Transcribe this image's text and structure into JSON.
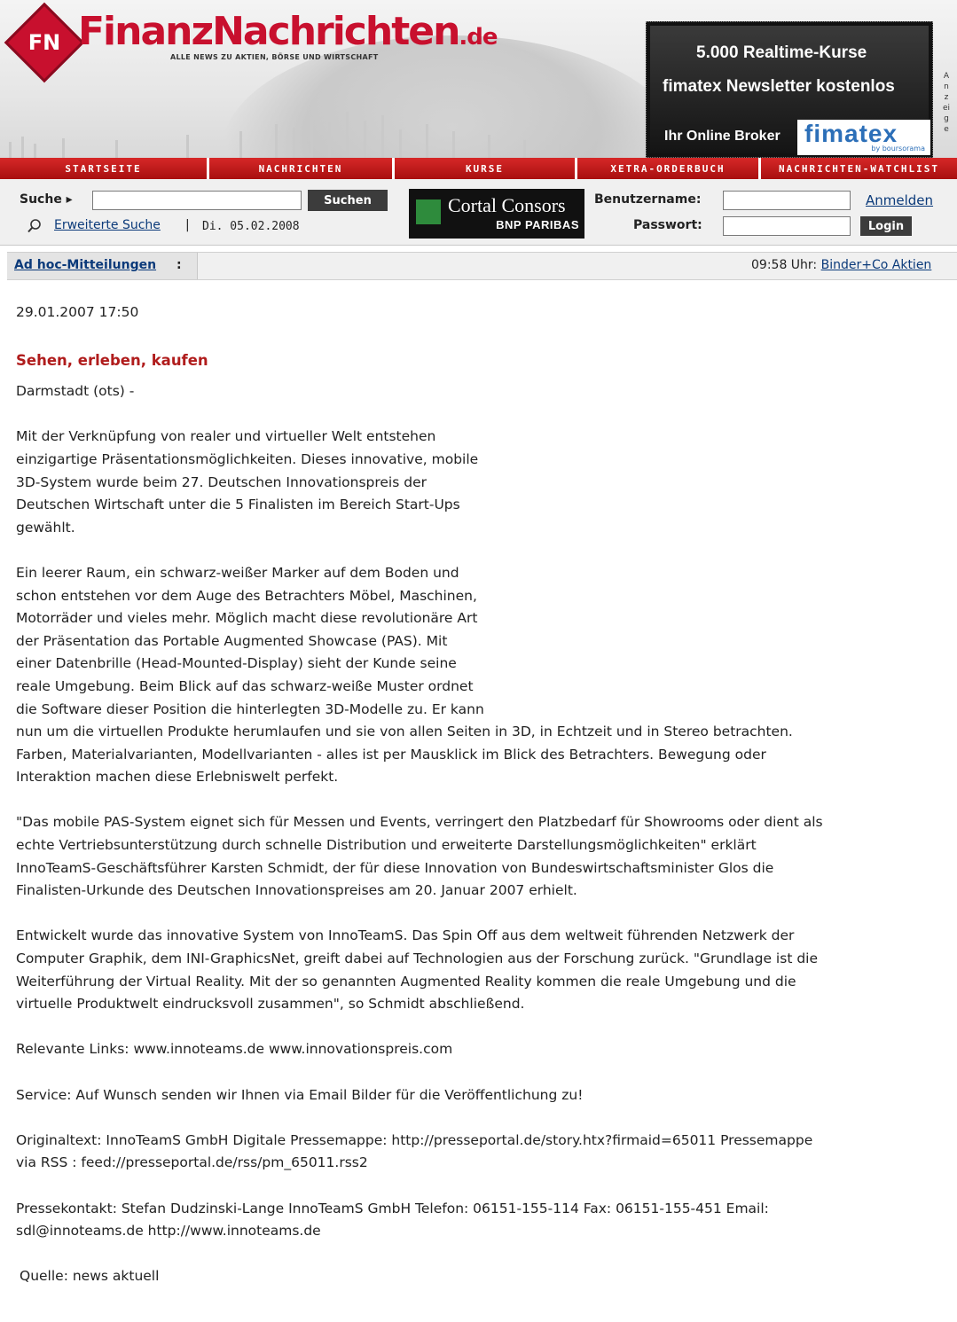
{
  "header": {
    "logo_badge": "FN",
    "logo_part1": "Finanz",
    "logo_part2": "Nachrichten",
    "logo_tld": ".de",
    "tagline": "ALLE NEWS ZU AKTIEN, BÖRSE UND WIRTSCHAFT",
    "ad": {
      "line1": "5.000 Realtime-Kurse",
      "line2": "fimatex Newsletter kostenlos",
      "line3": "Ihr Online Broker",
      "brand": "fimatex",
      "brand_sub": "by boursorama",
      "side_label": "Anzeige"
    }
  },
  "nav": {
    "tabs": [
      "STARTSEITE",
      "NACHRICHTEN",
      "KURSE",
      "XETRA-ORDERBUCH",
      "NACHRICHTEN-WATCHLIST"
    ]
  },
  "toolbar": {
    "search_label": "Suche ▸",
    "search_value": "",
    "search_button": "Suchen",
    "advanced_search": "Erweiterte Suche",
    "separator": "|",
    "date": "Di. 05.02.2008",
    "sponsor_name": "Cortal Consors",
    "sponsor_sub": "BNP PARIBAS",
    "username_label": "Benutzername:",
    "password_label": "Passwort:",
    "register_link": "Anmelden",
    "login_button": "Login"
  },
  "ticker": {
    "label": "Ad hoc-Mitteilungen",
    "colon": ":",
    "time": "09:58 Uhr:",
    "headline": "Binder+Co Aktien"
  },
  "article": {
    "date": "29.01.2007 17:50",
    "title": "Sehen, erleben, kaufen",
    "dateline": "Darmstadt (ots) -",
    "p1": "Mit der Verknüpfung von realer und virtueller Welt entstehen\neinzigartige Präsentationsmöglichkeiten. Dieses innovative, mobile\n3D-System wurde beim 27. Deutschen Innovationspreis der\nDeutschen Wirtschaft unter die 5 Finalisten im Bereich Start-Ups\ngewählt.",
    "p2a": "Ein leerer Raum, ein schwarz-weißer Marker auf dem Boden und\nschon entstehen vor dem Auge des Betrachters Möbel, Maschinen,\nMotorräder und vieles mehr. Möglich macht diese revolutionäre Art\nder Präsentation das Portable Augmented Showcase (PAS). Mit\neiner Datenbrille (Head-Mounted-Display) sieht der Kunde seine\nreale Umgebung. Beim Blick auf das schwarz-weiße Muster ordnet\ndie Software dieser Position die hinterlegten 3D-Modelle zu. Er kann",
    "p2b": "nun um die virtuellen Produkte herumlaufen und sie von allen Seiten in 3D, in Echtzeit und in Stereo betrachten.\nFarben, Materialvarianten, Modellvarianten - alles ist per Mausklick im Blick des Betrachters. Bewegung oder\nInteraktion machen diese Erlebniswelt perfekt.",
    "p3": "\"Das mobile PAS-System eignet sich für Messen und Events, verringert den Platzbedarf für Showrooms oder dient als\nechte Vertriebsunterstützung durch schnelle Distribution und erweiterte Darstellungsmöglichkeiten\" erklärt\nInnoTeamS-Geschäftsführer Karsten Schmidt, der für diese Innovation von Bundeswirtschaftsminister Glos die\nFinalisten-Urkunde des Deutschen Innovationspreises am 20. Januar 2007 erhielt.",
    "p4": "Entwickelt wurde das innovative System von InnoTeamS. Das Spin Off aus dem weltweit führenden Netzwerk der\nComputer Graphik, dem INI-GraphicsNet, greift dabei auf Technologien aus der Forschung zurück. \"Grundlage ist die\nWeiterführung der Virtual Reality. Mit der so genannten Augmented Reality kommen die reale Umgebung und die\nvirtuelle Produktwelt eindrucksvoll zusammen\", so Schmidt abschließend.",
    "p5": "Relevante Links: www.innoteams.de www.innovationspreis.com",
    "p6": "Service: Auf Wunsch senden wir Ihnen via Email Bilder für die Veröffentlichung zu!",
    "p7": "Originaltext: InnoTeamS GmbH Digitale Pressemappe: http://presseportal.de/story.htx?firmaid=65011 Pressemappe\nvia RSS : feed://presseportal.de/rss/pm_65011.rss2",
    "p8": "Pressekontakt: Stefan Dudzinski-Lange InnoTeamS GmbH Telefon: 06151-155-114 Fax: 06151-155-451 Email:\nsdl@innoteams.de http://www.innoteams.de",
    "source": "Quelle: news aktuell"
  }
}
